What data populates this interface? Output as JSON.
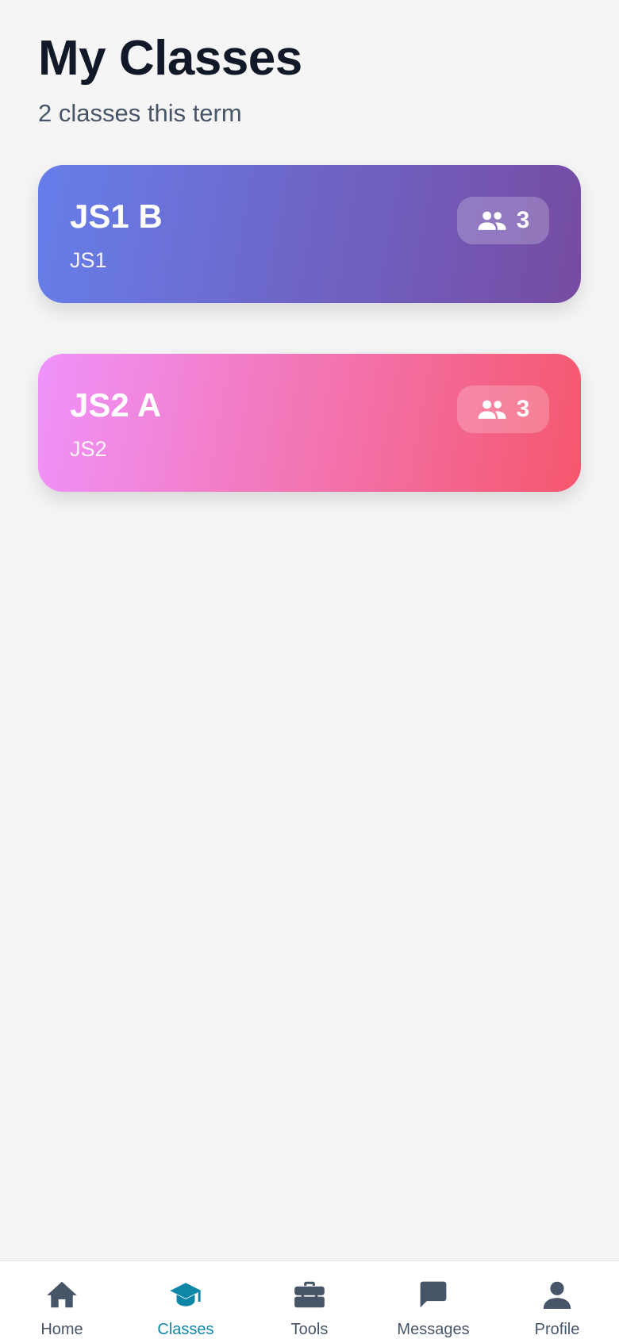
{
  "header": {
    "title": "My Classes",
    "subtitle": "2 classes this term"
  },
  "classes": [
    {
      "name": "JS1 B",
      "level": "JS1",
      "students": "3",
      "gradient_start": "#667eea",
      "gradient_end": "#764ba2"
    },
    {
      "name": "JS2 A",
      "level": "JS2",
      "students": "3",
      "gradient_start": "#f093fb",
      "gradient_end": "#f5576c"
    }
  ],
  "nav": {
    "active_color": "#0e86a8",
    "inactive_color": "#475569",
    "items": [
      {
        "icon": "home-icon",
        "label": "Home"
      },
      {
        "icon": "graduation-cap-icon",
        "label": "Classes"
      },
      {
        "icon": "briefcase-icon",
        "label": "Tools"
      },
      {
        "icon": "chat-icon",
        "label": "Messages"
      },
      {
        "icon": "user-icon",
        "label": "Profile"
      }
    ]
  }
}
